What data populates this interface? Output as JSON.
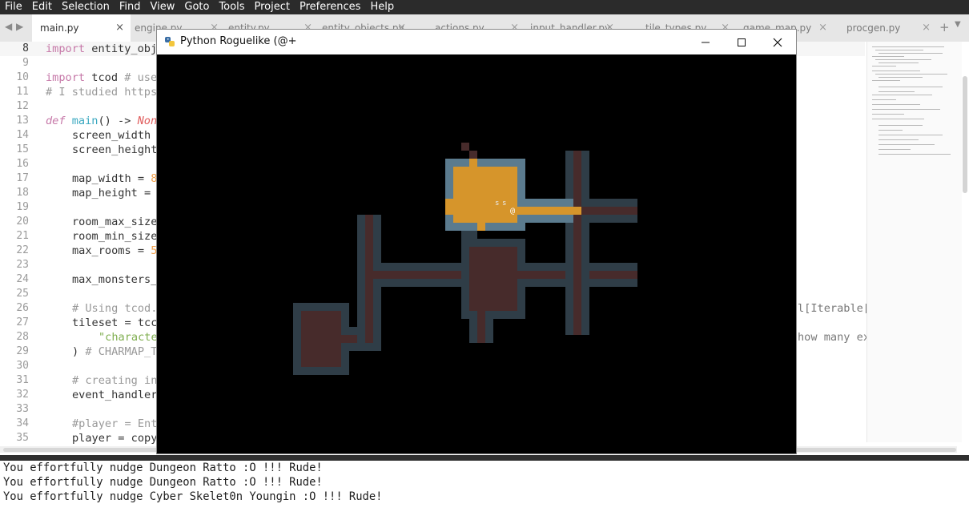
{
  "menu": [
    "File",
    "Edit",
    "Selection",
    "Find",
    "View",
    "Goto",
    "Tools",
    "Project",
    "Preferences",
    "Help"
  ],
  "tabs": [
    {
      "label": "main.py",
      "active": true
    },
    {
      "label": "engine.py",
      "active": false
    },
    {
      "label": "entity.py",
      "active": false
    },
    {
      "label": "entity_objects.py",
      "active": false
    },
    {
      "label": "actions.py",
      "active": false
    },
    {
      "label": "input_handler.py",
      "active": false
    },
    {
      "label": "tile_types.py",
      "active": false
    },
    {
      "label": "game_map.py",
      "active": false
    },
    {
      "label": "procgen.py",
      "active": false
    }
  ],
  "tab_close_glyph": "×",
  "tab_nav_left": "◀",
  "tab_nav_right": "▶",
  "tab_plus": "+",
  "tab_chevron": "▼",
  "editor": {
    "line_numbers": [
      "8",
      "9",
      "10",
      "11",
      "12",
      "13",
      "14",
      "15",
      "16",
      "17",
      "18",
      "19",
      "20",
      "21",
      "22",
      "23",
      "24",
      "25",
      "26",
      "27",
      "28",
      "29",
      "30",
      "31",
      "32",
      "33",
      "34",
      "35"
    ],
    "current_line": "8",
    "code": {
      "l8": "entity_obj",
      "l10_a": "tcod",
      "l10_b": "# use",
      "l11": "# I studied https",
      "l13_name": "main",
      "l13_arrow": "() -> ",
      "l13_type": "Non",
      "l14": "screen_width ",
      "l15": "screen_height",
      "l17_a": "map_width = ",
      "l17_b": "8",
      "l18": "map_height = ",
      "l20": "room_max_size",
      "l21": "room_min_size",
      "l22_a": "max_rooms = ",
      "l22_b": "5",
      "l24": "max_monsters_",
      "l26": "# Using tcod.",
      "l27": "tileset = tcc",
      "l28": "\"characte",
      "l29_a": ") ",
      "l29_b": "# CHARMAP_T",
      "l31": "# creating in",
      "l32": "event_handler",
      "l34": "#player = Ent",
      "l35": "player = copy"
    },
    "keywords": {
      "import": "import",
      "def": "def"
    },
    "right_fragment_26": "l[Iterable[",
    "right_fragment_28": "how many ex"
  },
  "game_window": {
    "title": "Python Roguelike (@+",
    "minimize_glyph": "—",
    "maximize_glyph": "☐",
    "close_glyph": "✕",
    "monster_1": "s",
    "monster_2": "s",
    "player": "@"
  },
  "console": [
    "You effortfully nudge Dungeon Ratto :O !!! Rude!",
    "You effortfully nudge Dungeon Ratto :O !!! Rude!",
    "You effortfully nudge Cyber Skelet0n Youngin :O !!! Rude!"
  ],
  "colors": {
    "menubar": "#2b2b2b",
    "wall_explored": "#2f3d47",
    "floor_explored": "#472b2b",
    "wall_visible": "#5b7b8e",
    "floor_visible": "#d6952b",
    "floor_dim": "#3d2323"
  }
}
